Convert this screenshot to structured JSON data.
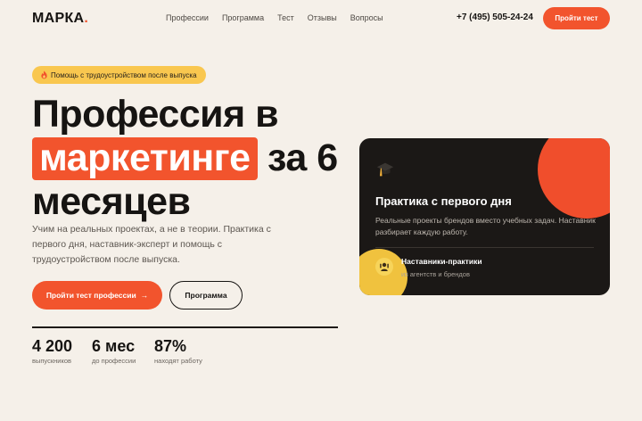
{
  "header": {
    "logo_text": "МАРКА",
    "logo_dot": ".",
    "nav": [
      "Профессии",
      "Программа",
      "Тест",
      "Отзывы",
      "Вопросы"
    ],
    "phone": "+7 (495) 505-24-24",
    "cta": "Пройти тест"
  },
  "hero": {
    "badge_icon": "fire-icon",
    "badge_text": "Помощь с трудоустройством после выпуска",
    "title_line1": "Профессия в",
    "title_highlight": "маркетинге",
    "title_rest": "за 6",
    "title_line3": "месяцев",
    "subtitle": "Учим на реальных проектах, а не в теории. Практика с первого дня, наставник-эксперт и помощь с трудоустройством после выпуска.",
    "primary_button": "Пройти тест профессии",
    "primary_arrow": "→",
    "secondary_button": "Программа",
    "stats": [
      {
        "value": "4 200",
        "label": "выпускников"
      },
      {
        "value": "6 мес",
        "label": "до профессии"
      },
      {
        "value": "87%",
        "label": "находят работу"
      }
    ]
  },
  "card": {
    "icon": "graduation-cap-icon",
    "title": "Практика с первого дня",
    "description": "Реальные проекты брендов вместо учебных задач. Наставник разбирает каждую работу.",
    "mentor_icon": "mentor-badge-icon",
    "mentor_title": "Наставники-практики",
    "mentor_subtitle": "из агентств и брендов"
  },
  "colors": {
    "accent": "#f2542d",
    "yellow": "#f9c74f",
    "background": "#f5f0e9",
    "card": "#1b1816"
  }
}
